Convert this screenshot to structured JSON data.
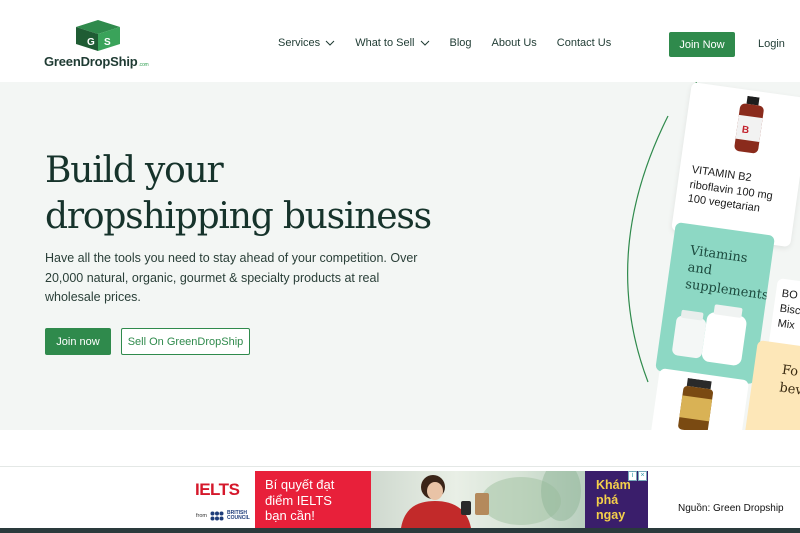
{
  "brand": {
    "name": "GreenDropShip",
    "suffix": ".com",
    "accent": "#2f8a4c",
    "dark": "#16332b",
    "logo_icon": "box-icon"
  },
  "nav": {
    "items": [
      {
        "label": "Services",
        "has_dropdown": true
      },
      {
        "label": "What to Sell",
        "has_dropdown": true
      },
      {
        "label": "Blog",
        "has_dropdown": false
      },
      {
        "label": "About Us",
        "has_dropdown": false
      },
      {
        "label": "Contact Us",
        "has_dropdown": false
      }
    ],
    "join_label": "Join Now",
    "login_label": "Login"
  },
  "hero": {
    "title_line1": "Build your",
    "title_line2": "dropshipping business",
    "subtitle": "Have all the tools you need to stay ahead of your competition. Over 20,000 natural, organic, gourmet & specialty products at real wholesale prices.",
    "primary_cta": "Join now",
    "secondary_cta": "Sell On GreenDropShip"
  },
  "collage": {
    "vitamin_line1": "VITAMIN B2",
    "vitamin_line2": "riboflavin 100 mg",
    "vitamin_line3": "100 vegetarian",
    "supplements_line1": "Vitamins and",
    "supplements_line2": "supplements",
    "bo_line1": "BO",
    "bo_line2": "Bisc",
    "bo_line3": "Mix",
    "yellow_line1": "Fo",
    "yellow_line2": "bev"
  },
  "ad": {
    "brand": "IELTS",
    "from_label": "from",
    "council_line1": "BRITISH",
    "council_line2": "COUNCIL",
    "headline_line1": "Bí quyết đạt",
    "headline_line2": "điểm IELTS",
    "headline_line3": "bạn cần!",
    "cta_line1": "Khám",
    "cta_line2": "phá",
    "cta_line3": "ngay"
  },
  "credit": "Nguồn: Green Dropship"
}
